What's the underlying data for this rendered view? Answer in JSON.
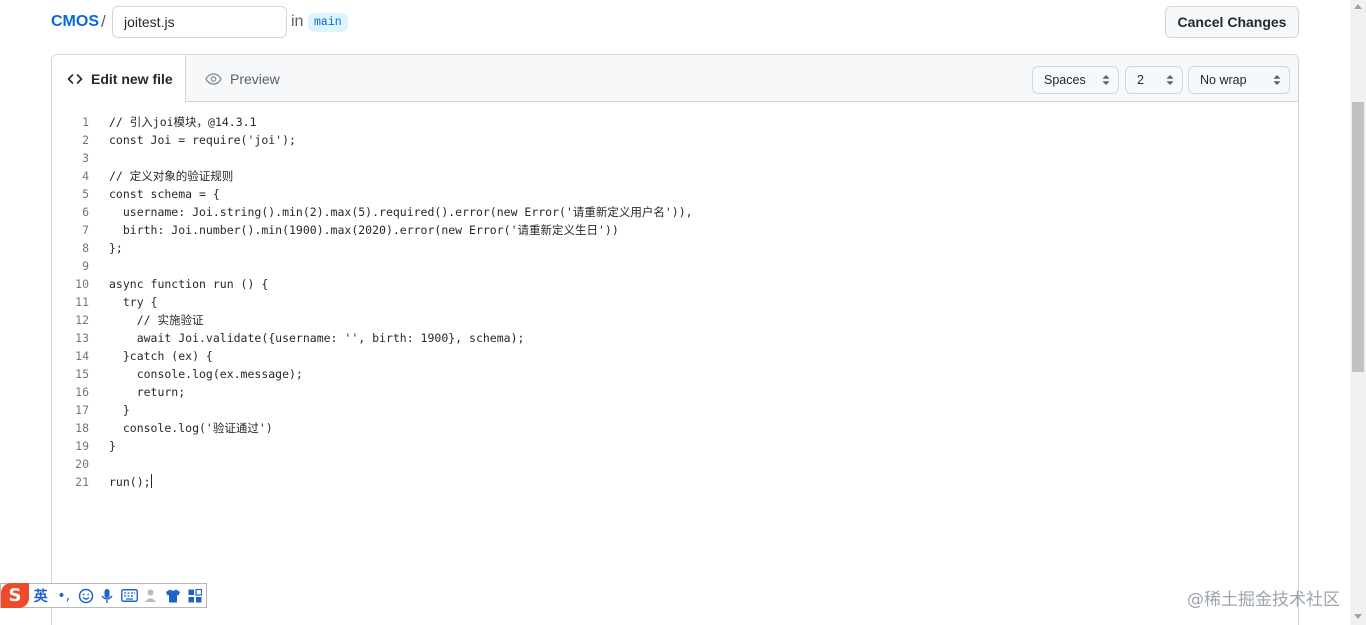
{
  "header": {
    "repo": "CMOS",
    "separator": "/",
    "filename": "joitest.js",
    "in_label": "in",
    "branch": "main",
    "cancel_label": "Cancel Changes"
  },
  "editor": {
    "tabs": [
      {
        "label": "Edit new file",
        "icon": "code-icon",
        "active": true
      },
      {
        "label": "Preview",
        "icon": "eye-icon",
        "active": false
      }
    ],
    "indent_mode": "Spaces",
    "indent_size": "2",
    "wrap_mode": "No wrap",
    "lines": [
      {
        "n": "1",
        "text": "// 引入joi模块，@14.3.1"
      },
      {
        "n": "2",
        "text": "const Joi = require('joi');"
      },
      {
        "n": "3",
        "text": ""
      },
      {
        "n": "4",
        "text": "// 定义对象的验证规则"
      },
      {
        "n": "5",
        "text": "const schema = {"
      },
      {
        "n": "6",
        "text": "  username: Joi.string().min(2).max(5).required().error(new Error('请重新定义用户名')),"
      },
      {
        "n": "7",
        "text": "  birth: Joi.number().min(1900).max(2020).error(new Error('请重新定义生日'))"
      },
      {
        "n": "8",
        "text": "};"
      },
      {
        "n": "9",
        "text": ""
      },
      {
        "n": "10",
        "text": "async function run () {"
      },
      {
        "n": "11",
        "text": "  try {"
      },
      {
        "n": "12",
        "text": "    // 实施验证"
      },
      {
        "n": "13",
        "text": "    await Joi.validate({username: '', birth: 1900}, schema);"
      },
      {
        "n": "14",
        "text": "  }catch (ex) {"
      },
      {
        "n": "15",
        "text": "    console.log(ex.message);"
      },
      {
        "n": "16",
        "text": "    return;"
      },
      {
        "n": "17",
        "text": "  }"
      },
      {
        "n": "18",
        "text": "  console.log('验证通过')"
      },
      {
        "n": "19",
        "text": "}"
      },
      {
        "n": "20",
        "text": ""
      },
      {
        "n": "21",
        "text": "run();"
      }
    ]
  },
  "ime": {
    "logo": "S",
    "language": "英",
    "punct": "•,",
    "icons": [
      "emoji-icon",
      "microphone-icon",
      "keyboard-icon",
      "user-icon",
      "skin-icon",
      "grid-icon"
    ]
  },
  "watermark": "@稀土掘金技术社区",
  "colors": {
    "link": "#0969da",
    "branch_bg": "#ddf4ff",
    "border": "#d0d7de",
    "header_bg": "#f6f8fa"
  }
}
